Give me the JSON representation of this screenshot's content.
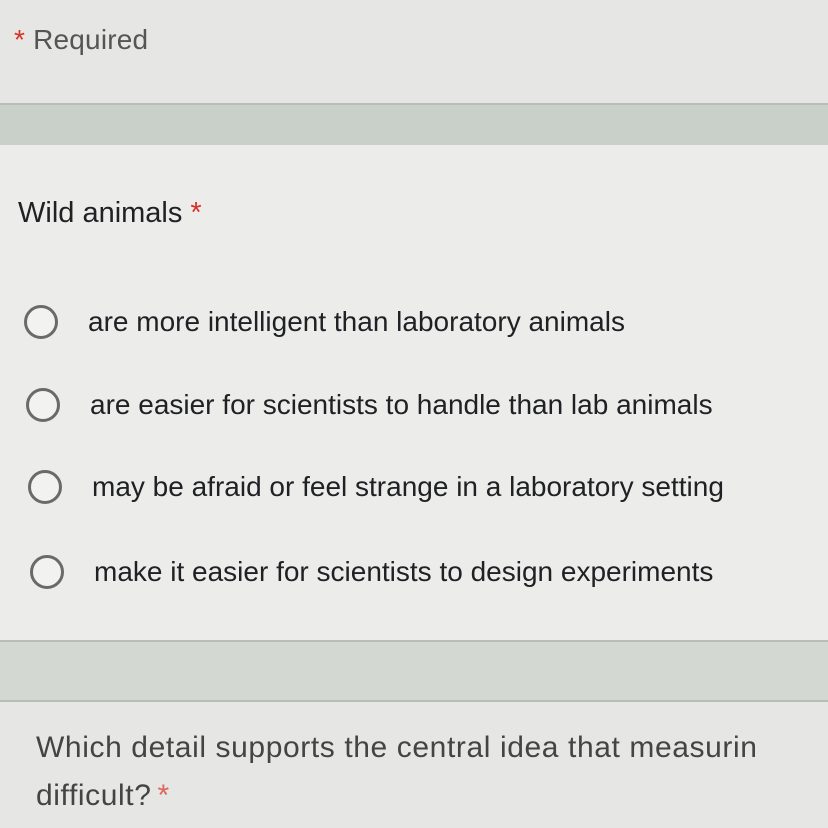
{
  "header": {
    "required_star": "*",
    "required_label": "Required"
  },
  "question1": {
    "title": "Wild animals",
    "required_marker": "*",
    "options": [
      {
        "label": "are more intelligent than laboratory animals"
      },
      {
        "label": "are easier for scientists to handle than lab animals"
      },
      {
        "label": "may be afraid or feel strange in a laboratory setting"
      },
      {
        "label": "make it easier for scientists to design experiments"
      }
    ]
  },
  "question2": {
    "title_line1": "Which detail supports the central idea that measurin",
    "title_line2": "difficult?",
    "required_marker": "*"
  },
  "colors": {
    "required_star": "#d93025",
    "band": "#c9d0c9",
    "radio_border": "#6a6a6a"
  }
}
